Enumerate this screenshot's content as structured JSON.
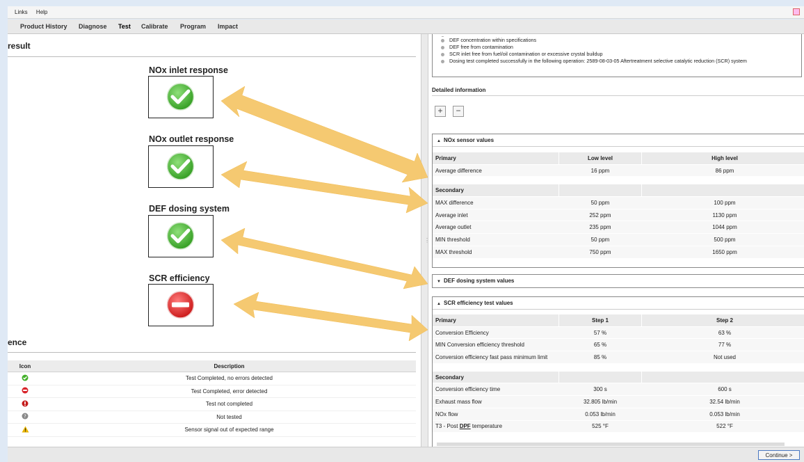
{
  "menubar": {
    "items": [
      "Links",
      "Help"
    ]
  },
  "nav": {
    "tabs": [
      "Product History",
      "Diagnose",
      "Test",
      "Calibrate",
      "Program",
      "Impact"
    ],
    "active": "Test"
  },
  "left": {
    "result_heading": "result",
    "tests": [
      {
        "title": "NOx inlet response",
        "status": "pass"
      },
      {
        "title": "NOx outlet response",
        "status": "pass"
      },
      {
        "title": "DEF dosing system",
        "status": "pass"
      },
      {
        "title": "SCR efficiency",
        "status": "fail"
      }
    ],
    "reference_heading": "ence",
    "legend_headers": {
      "icon": "Icon",
      "description": "Description"
    },
    "legend": [
      {
        "icon": "check-icon",
        "color": "#43b02a",
        "description": "Test Completed, no errors detected"
      },
      {
        "icon": "minus-icon",
        "color": "#d8232a",
        "description": "Test Completed, error detected"
      },
      {
        "icon": "exclamation-icon",
        "color": "#c41b1b",
        "description": "Test not completed"
      },
      {
        "icon": "question-icon",
        "color": "#888888",
        "description": "Not tested"
      },
      {
        "icon": "warning-icon",
        "color": "#e0b000",
        "description": "Sensor signal out of expected range"
      }
    ]
  },
  "summary": {
    "items": [
      "DEF concentration within specifications",
      "DEF free from contamination",
      "SCR inlet free from fuel/oil contamination or excessive crystal buildup",
      "Dosing test completed successfully in the following operation: 2589-08-03-05 Aftertreatment selective catalytic reduction (SCR) system"
    ]
  },
  "detail": {
    "title": "Detailed information",
    "expand_label": "+",
    "collapse_label": "−"
  },
  "nox_panel": {
    "title": "NOx sensor values",
    "primary_headers": [
      "Primary",
      "Low level",
      "High level"
    ],
    "primary_rows": [
      [
        "Average difference",
        "16 ppm",
        "86 ppm"
      ]
    ],
    "secondary_header": "Secondary",
    "secondary_rows": [
      [
        "MAX difference",
        "50 ppm",
        "100 ppm"
      ],
      [
        "Average inlet",
        "252 ppm",
        "1130 ppm"
      ],
      [
        "Average outlet",
        "235 ppm",
        "1044 ppm"
      ],
      [
        "MIN threshold",
        "50 ppm",
        "500 ppm"
      ],
      [
        "MAX threshold",
        "750 ppm",
        "1650 ppm"
      ]
    ]
  },
  "def_panel": {
    "title": "DEF dosing system values"
  },
  "scr_panel": {
    "title": "SCR efficiency test values",
    "primary_headers": [
      "Primary",
      "Step 1",
      "Step 2"
    ],
    "primary_rows": [
      [
        "Conversion Efficiency",
        "57 %",
        "63 %"
      ],
      [
        "MIN Conversion efficiency threshold",
        "65 %",
        "77 %"
      ],
      [
        "Conversion efficiency fast pass minimum limit",
        "85 %",
        "Not used"
      ]
    ],
    "secondary_header": "Secondary",
    "secondary_rows": [
      [
        "Conversion efficiency time",
        "300 s",
        "600 s"
      ],
      [
        "Exhaust mass flow",
        "32.805 lb/min",
        "32.54 lb/min"
      ],
      [
        "NOx flow",
        "0.053 lb/min",
        "0.053 lb/min"
      ]
    ],
    "t3_prefix": "T3 - Post ",
    "t3_link": "DPF",
    "t3_suffix": " temperature",
    "t3_step1": "525 °F",
    "t3_step2": "522 °F"
  },
  "footer": {
    "continue_label": "Continue >"
  },
  "colors": {
    "arrow": "#f5c76a",
    "pass": "#43b02a",
    "fail": "#d8232a"
  }
}
